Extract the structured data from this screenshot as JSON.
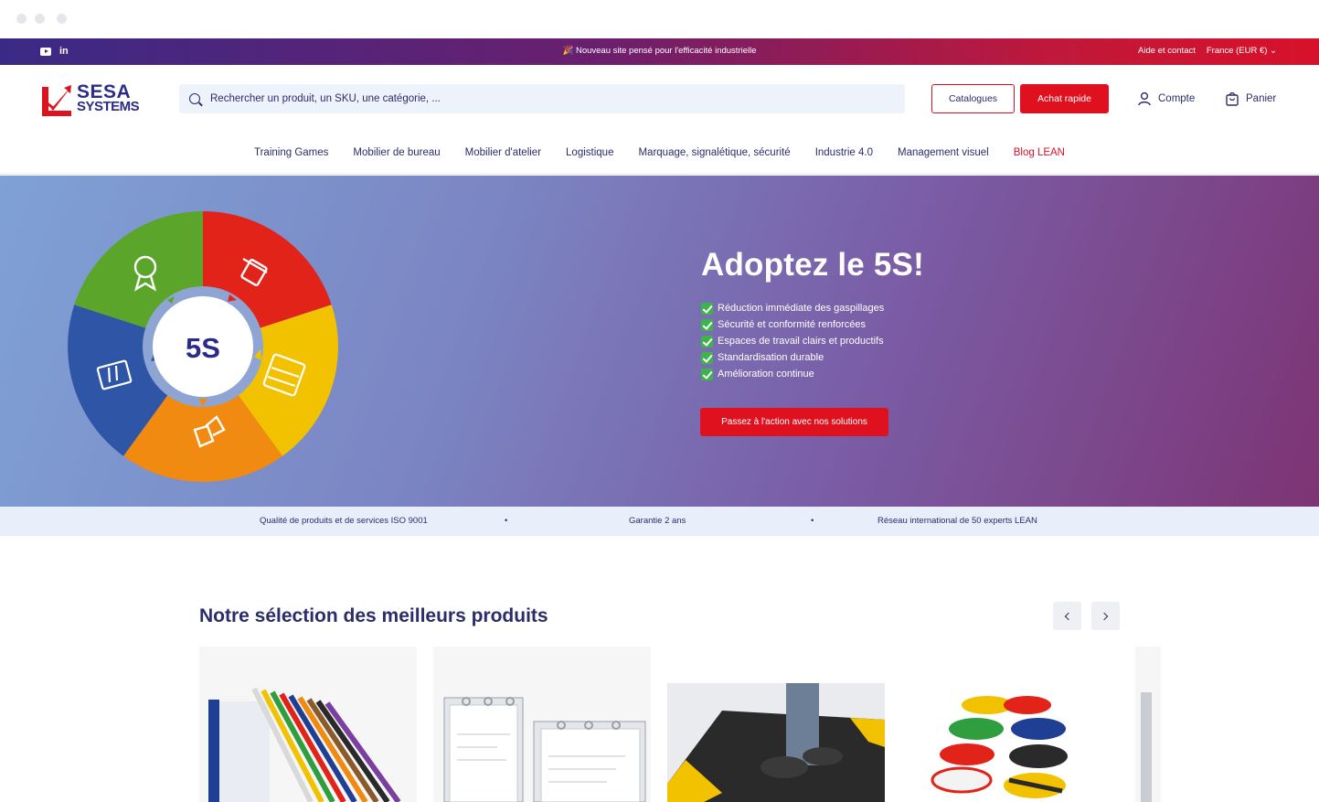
{
  "topbar": {
    "announcement": "🎉 Nouveau site pensé pour l'efficacité industrielle",
    "help": "Aide et contact",
    "locale": "France (EUR €)",
    "social_icons": [
      "youtube-icon",
      "linkedin-icon"
    ]
  },
  "header": {
    "logo_line1": "SESA",
    "logo_line2": "SYSTEMS",
    "search_placeholder": "Rechercher un produit, un SKU, une catégorie, ...",
    "catalogues": "Catalogues",
    "quick_buy": "Achat rapide",
    "account": "Compte",
    "cart": "Panier"
  },
  "nav": [
    "Training Games",
    "Mobilier de bureau",
    "Mobilier d'atelier",
    "Logistique",
    "Marquage, signalétique, sécurité",
    "Industrie 4.0",
    "Management visuel",
    "Blog LEAN"
  ],
  "hero": {
    "wheel_label": "5S",
    "title": "Adoptez le 5S!",
    "bullets": [
      "Réduction immédiate des gaspillages",
      "Sécurité et conformité renforcées",
      "Espaces de travail clairs et productifs",
      "Standardisation durable",
      "Amélioration continue"
    ],
    "cta": "Passez à l'action avec nos solutions"
  },
  "trust": {
    "items": [
      "Qualité de produits et de services ISO 9001",
      "Garantie 2 ans",
      "Réseau international de 50 experts LEAN"
    ],
    "separator": "•"
  },
  "products": {
    "title": "Notre sélection des meilleurs produits"
  },
  "colors": {
    "brand_navy": "#2b2c6b",
    "accent_red": "#e0111f",
    "check_green": "#3bb54a"
  }
}
